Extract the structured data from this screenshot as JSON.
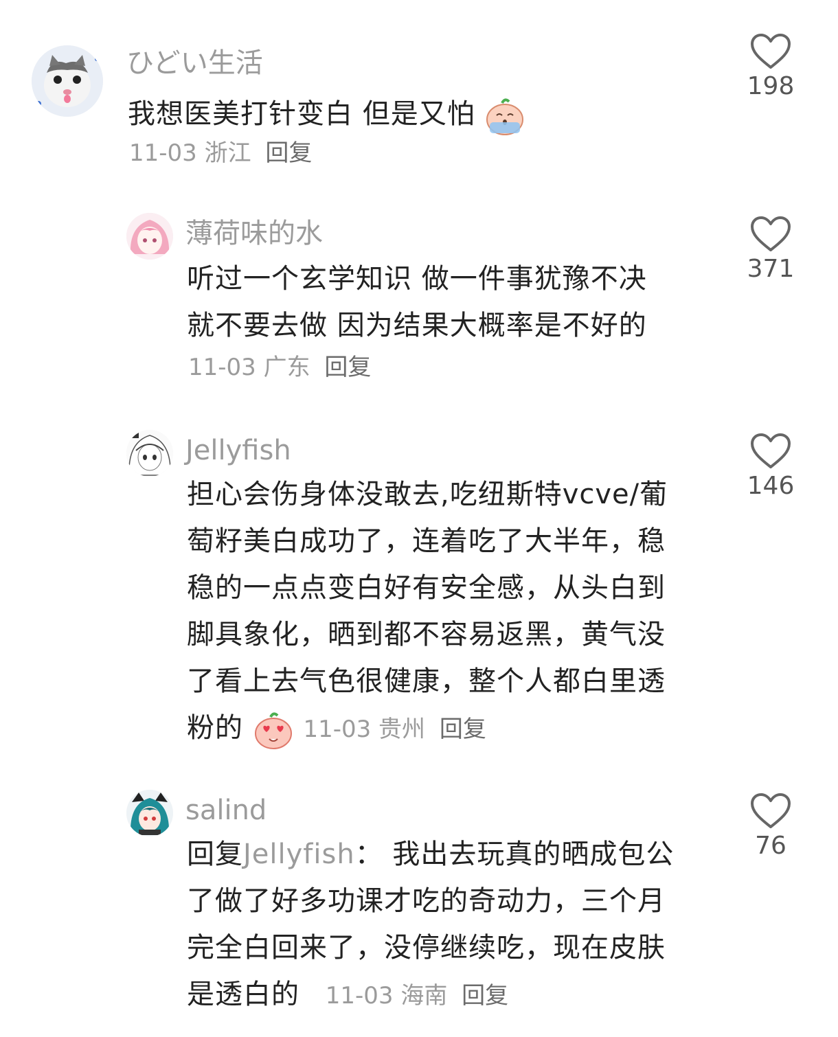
{
  "comments": [
    {
      "username": "ひどい生活",
      "text": "我想医美打针变白 但是又怕",
      "emoji": "crying-peach-emoji",
      "date": "11-03",
      "location": "浙江",
      "reply_label": "回复",
      "likes": "198",
      "avatar": "cat-avatar"
    },
    {
      "username": "薄荷味的水",
      "text_line1": "听过一个玄学知识 做一件事犹豫不决",
      "text_line2": "就不要去做 因为结果大概率是不好的",
      "date": "11-03",
      "location": "广东",
      "reply_label": "回复",
      "likes": "371",
      "avatar": "pink-hair-anime-avatar"
    },
    {
      "username": "Jellyfish",
      "lines": [
        "担心会伤身体没敢去,吃纽斯特vcve/葡",
        "萄籽美白成功了，连着吃了大半年，稳",
        "稳的一点点变白好有安全感，从头白到",
        "脚具象化，晒到都不容易返黑，黄气没",
        "了看上去气色很健康，整个人都白里透"
      ],
      "last_line": "粉的",
      "emoji": "heart-eyes-peach-emoji",
      "date": "11-03",
      "location": "贵州",
      "reply_label": "回复",
      "likes": "146",
      "avatar": "white-hair-anime-avatar"
    },
    {
      "username": "salind",
      "reply_prefix": "回复",
      "reply_target": "Jellyfish",
      "reply_colon": "：",
      "line1_rest": " 我出去玩真的晒成包公",
      "lines": [
        "了做了好多功课才吃的奇动力，三个月",
        "完全白回来了，没停继续吃，现在皮肤"
      ],
      "last_line": "是透白的",
      "date": "11-03",
      "location": "海南",
      "reply_label": "回复",
      "likes": "76",
      "avatar": "cat-ear-anime-avatar"
    }
  ],
  "colors": {
    "username": "#9b9b9b",
    "text": "#222222",
    "meta": "#9b9b9b"
  }
}
